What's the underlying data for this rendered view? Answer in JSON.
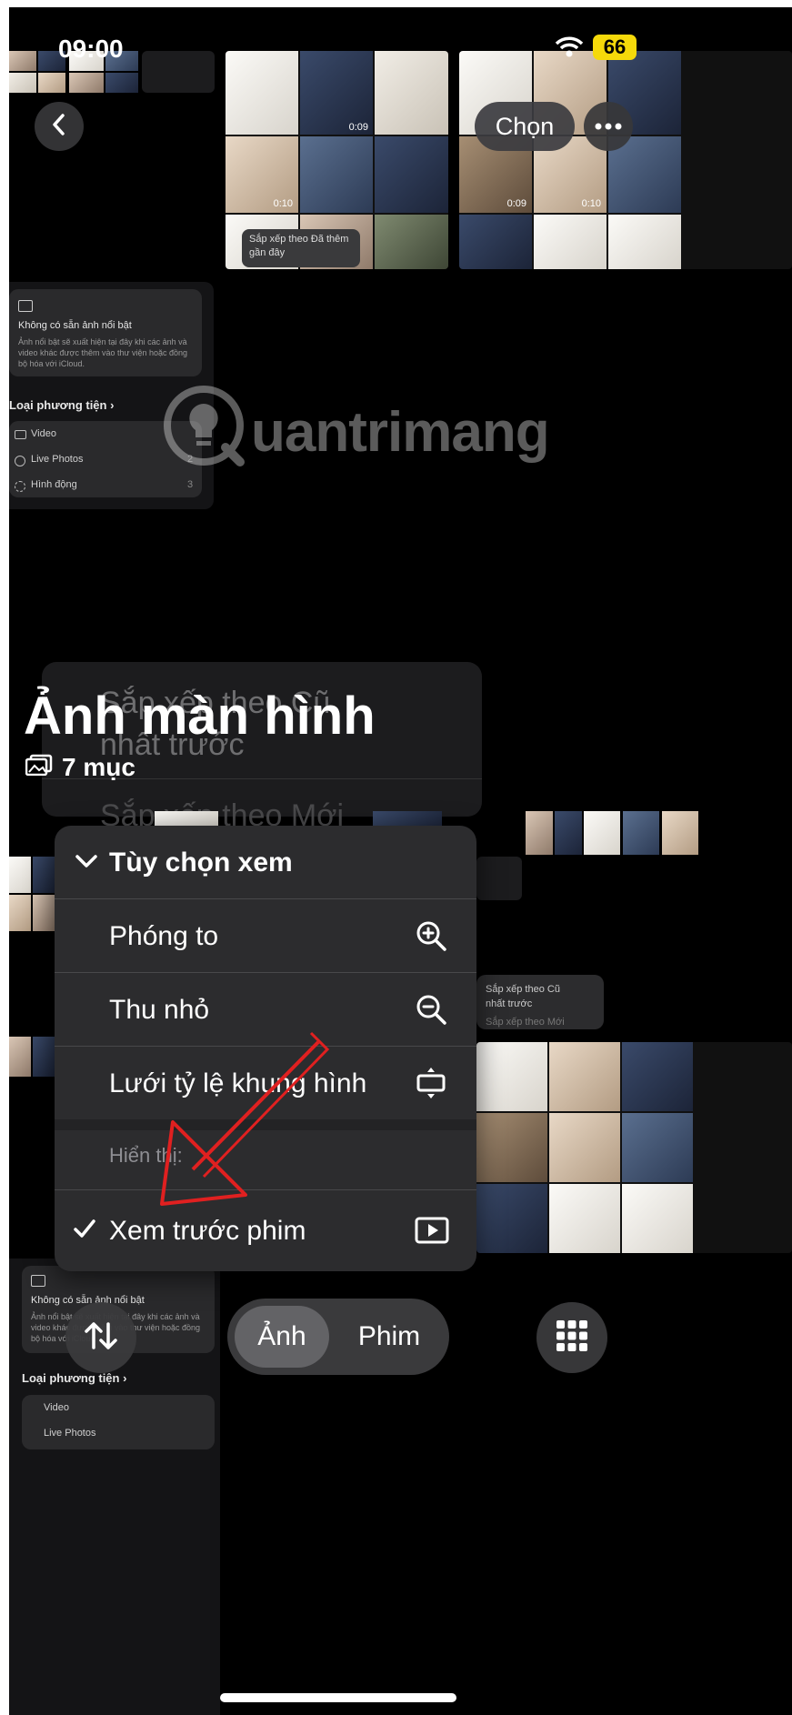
{
  "status_bar": {
    "time": "09:00",
    "battery": "66"
  },
  "top_nav": {
    "select_label": "Chọn"
  },
  "background": {
    "sort_hint": "Sắp xếp theo Đã thêm gần đây",
    "durations": [
      "0:09",
      "0:10",
      "0:09",
      "0:10"
    ],
    "featured_title": "Không có sẵn ảnh nổi bật",
    "featured_desc": "Ảnh nổi bật sẽ xuất hiện tại đây khi các ảnh và video khác được thêm vào thư viện hoặc đồng bộ hóa với iCloud.",
    "media_types_header": "Loại phương tiện",
    "media_types": [
      {
        "label": "Video",
        "count": ""
      },
      {
        "label": "Live Photos",
        "count": "2"
      },
      {
        "label": "Hình động",
        "count": "3"
      }
    ],
    "faded_menu_line1": "Sắp xếp theo Cũ",
    "faded_menu_line2": "nhất trước",
    "faded_menu_line3": "Sắp xếp theo Mới"
  },
  "album": {
    "title": "Ảnh màn hình",
    "count": "7 mục"
  },
  "menu": {
    "header": "Tùy chọn xem",
    "items": [
      {
        "label": "Phóng to",
        "icon": "zoom-in-icon"
      },
      {
        "label": "Thu nhỏ",
        "icon": "zoom-out-icon"
      },
      {
        "label": "Lưới tỷ lệ khung hình",
        "icon": "aspect-ratio-icon"
      }
    ],
    "section_label": "Hiển thị:",
    "checked_item": {
      "label": "Xem trước phim",
      "icon": "play-rectangle-icon",
      "checked": true
    }
  },
  "bottom_bar": {
    "tab_photos": "Ảnh",
    "tab_videos": "Phim",
    "active_tab": "Ảnh"
  },
  "watermark": "uantrimang"
}
